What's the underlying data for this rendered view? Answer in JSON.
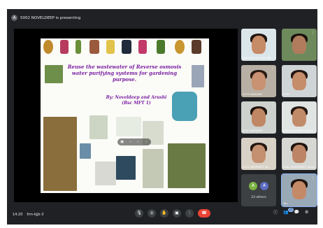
{
  "presenter": {
    "initial": "A",
    "text": "5002 NOVELDEEP is presenting"
  },
  "slide": {
    "title": "Reuse the wastewater of Reverse osmosis water purifying systems for gardening purpose.",
    "authors": "By: Noveldeep and Arushi (Bsc MFT 1)",
    "overlay_icons": [
      "▣",
      "‹",
      "›",
      "⋮"
    ]
  },
  "participants": [
    {
      "name": "5001 MEHAK LUTHRA",
      "face": "#c68b67",
      "hair": "#20150f",
      "bg": "#dbe6ea"
    },
    {
      "name": "",
      "face": "#b07c5d",
      "hair": "#1b120c",
      "bg": "#6e8a5c"
    },
    {
      "name": "5079 SANGAM",
      "face": "#c99272",
      "hair": "#2b1a12",
      "bg": "#b8b0a4"
    },
    {
      "name": "5005",
      "face": "#c58d6a",
      "hair": "#231610",
      "bg": "#cfd4d6"
    },
    {
      "name": "5030 NAVDEEP",
      "face": "#bf8764",
      "hair": "#1f140e",
      "bg": "#cdd2ce"
    },
    {
      "name": "5096 GURPREET KAUR",
      "face": "#c18b6a",
      "hair": "#251711",
      "bg": "#e0e4e2"
    },
    {
      "name": "5074 NAVPREET KA...",
      "face": "#c4906f",
      "hair": "#24160f",
      "bg": "#d8d1c6"
    },
    {
      "name": "5060 PARMPREET KAUR",
      "face": "#bd8565",
      "hair": "#1f130d",
      "bg": "#d6d6d2"
    },
    {
      "name": "You",
      "face": "#c48a68",
      "hair": "#22150e",
      "bg": "#9aa9b6"
    }
  ],
  "others": {
    "avatars": [
      "A",
      "A"
    ],
    "label": "23 others"
  },
  "bottom": {
    "time": "14:20",
    "meeting_code": "frm-kjjk-3",
    "controls": [
      "mic-icon",
      "camera-icon",
      "hand-icon",
      "present-icon",
      "more-icon",
      "end-call-icon"
    ],
    "control_glyphs": [
      "🎙",
      "◎",
      "✋",
      "▣",
      "⋮",
      "☎"
    ],
    "right_glyphs": [
      "ⓘ",
      "👥",
      "💬",
      "⚙"
    ],
    "participant_badge": "25"
  },
  "colors": {
    "bg": "#202124",
    "accent": "#8ab4f8",
    "end_call": "#ea4335",
    "title": "#7a1fa2"
  }
}
